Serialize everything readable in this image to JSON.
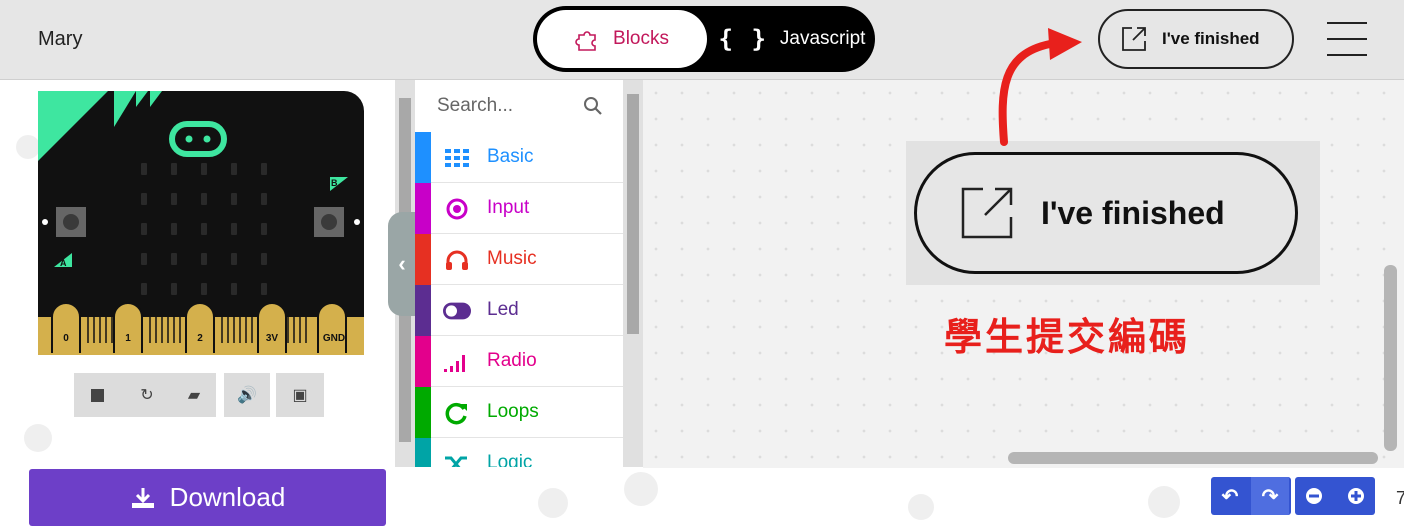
{
  "header": {
    "user_name": "Mary",
    "blocks_label": "Blocks",
    "javascript_label": "Javascript",
    "finished_label": "I've finished"
  },
  "simulator": {
    "pins": [
      "0",
      "1",
      "2",
      "3V",
      "GND"
    ],
    "button_a": "A",
    "button_b": "B",
    "controls": [
      "stop",
      "restart",
      "slow-mo",
      "mute",
      "fullscreen"
    ]
  },
  "download": {
    "label": "Download"
  },
  "toolbox": {
    "search_placeholder": "Search...",
    "categories": [
      {
        "label": "Basic",
        "color": "#1e90ff",
        "icon": "grid-icon"
      },
      {
        "label": "Input",
        "color": "#c800c8",
        "icon": "target-icon"
      },
      {
        "label": "Music",
        "color": "#e63022",
        "icon": "headphones-icon"
      },
      {
        "label": "Led",
        "color": "#5c2d91",
        "icon": "toggle-icon"
      },
      {
        "label": "Radio",
        "color": "#e3008c",
        "icon": "signal-icon"
      },
      {
        "label": "Loops",
        "color": "#00aa00",
        "icon": "refresh-icon"
      },
      {
        "label": "Logic",
        "color": "#00a4a6",
        "icon": "shuffle-icon"
      }
    ]
  },
  "callout": {
    "button_label": "I've finished",
    "annotation": "學生提交編碼"
  },
  "edge_text": "7",
  "colors": {
    "download_bg": "#6d3fc8",
    "annotation_red": "#e8201c",
    "zoom_blue": "#3454d1"
  }
}
